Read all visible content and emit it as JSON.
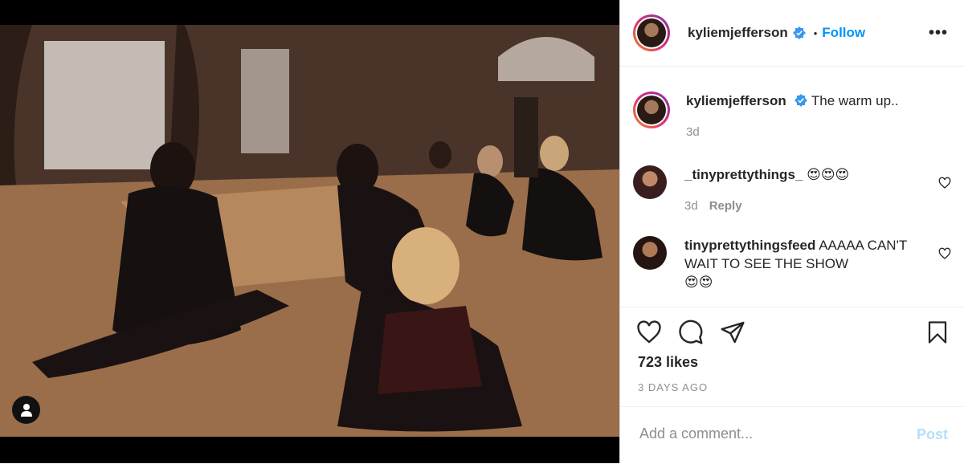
{
  "post": {
    "username": "kyliemjefferson",
    "follow_label": "Follow",
    "separator": "•",
    "more_label": "•••"
  },
  "caption": {
    "username": "kyliemjefferson",
    "text": "The warm up..",
    "time": "3d"
  },
  "comments": [
    {
      "username": "_tinyprettythings_",
      "text": "😍😍😍",
      "time": "3d",
      "reply_label": "Reply"
    },
    {
      "username": "tinyprettythingsfeed",
      "text": "AAAAA CAN'T WAIT TO SEE THE SHOW",
      "emoji": "😍😍"
    }
  ],
  "stats": {
    "likes": "723 likes",
    "date": "3 DAYS AGO"
  },
  "add_comment": {
    "placeholder": "Add a comment...",
    "post_label": "Post"
  },
  "colors": {
    "accent": "#0095f6",
    "post_disabled": "#b2dffc",
    "muted": "#8e8e8e"
  },
  "icons": [
    "verified-badge-icon",
    "heart-icon",
    "comment-icon",
    "share-icon",
    "bookmark-icon",
    "user-tag-icon",
    "more-icon"
  ]
}
